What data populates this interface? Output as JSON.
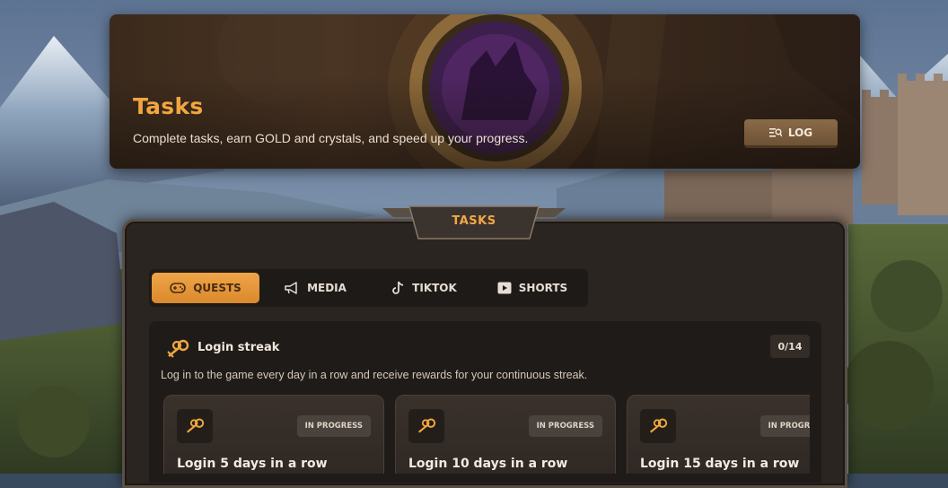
{
  "banner": {
    "title": "Tasks",
    "subtitle": "Complete tasks, earn GOLD and crystals, and speed up your progress.",
    "log_label": "LOG"
  },
  "panel": {
    "title": "TASKS"
  },
  "tabs": [
    {
      "label": "QUESTS",
      "icon": "gamepad-icon",
      "active": true
    },
    {
      "label": "MEDIA",
      "icon": "megaphone-icon",
      "active": false
    },
    {
      "label": "TIKTOK",
      "icon": "tiktok-icon",
      "active": false
    },
    {
      "label": "SHORTS",
      "icon": "play-icon",
      "active": false
    }
  ],
  "section": {
    "title": "Login streak",
    "count": "0/14",
    "description": "Log in to the game every day in a row and receive rewards for your continuous streak."
  },
  "quests": [
    {
      "title": "Login 5 days in a row",
      "status": "IN PROGRESS"
    },
    {
      "title": "Login 10 days in a row",
      "status": "IN PROGRESS"
    },
    {
      "title": "Login 15 days in a row",
      "status": "IN PROGRESS"
    }
  ],
  "colors": {
    "accent": "#F0A640",
    "panel": "#2B2521",
    "card": "#3A312B"
  }
}
